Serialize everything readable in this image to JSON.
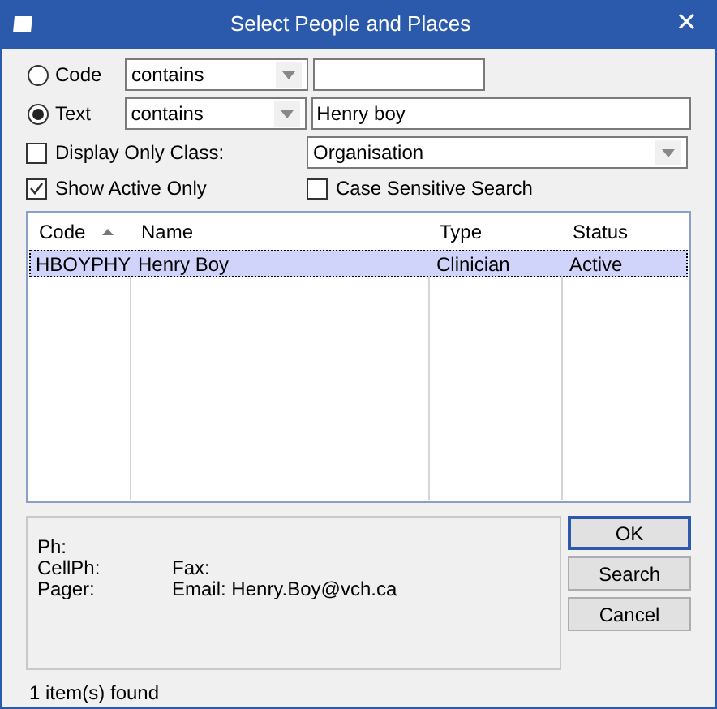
{
  "window": {
    "title": "Select People and Places",
    "close": "✕"
  },
  "search_rows": [
    {
      "label": "Code",
      "selected": false,
      "operator": "contains",
      "value": ""
    },
    {
      "label": "Text",
      "selected": true,
      "operator": "contains",
      "value": "Henry boy"
    }
  ],
  "display_only_class": {
    "label": "Display Only Class:",
    "checked": false,
    "value": "Organisation"
  },
  "show_active_only": {
    "label": "Show Active Only",
    "checked": true
  },
  "case_sensitive": {
    "label": "Case Sensitive Search",
    "checked": false
  },
  "table": {
    "columns": [
      {
        "label": "Code",
        "sorted": true
      },
      {
        "label": "Name",
        "sorted": false
      },
      {
        "label": "Type",
        "sorted": false
      },
      {
        "label": "Status",
        "sorted": false
      }
    ],
    "rows": [
      {
        "selected": true,
        "cells": [
          "HBOYPHY",
          "Henry Boy",
          "Clinician",
          "Active"
        ]
      }
    ]
  },
  "details": [
    [
      "Ph:"
    ],
    [
      "CellPh:",
      "Fax:"
    ],
    [
      "Pager:",
      "Email: Henry.Boy@vch.ca"
    ]
  ],
  "buttons": [
    {
      "label": "OK",
      "default": true
    },
    {
      "label": "Search",
      "default": false
    },
    {
      "label": "Cancel",
      "default": false
    }
  ],
  "status_bar": "1 item(s) found"
}
